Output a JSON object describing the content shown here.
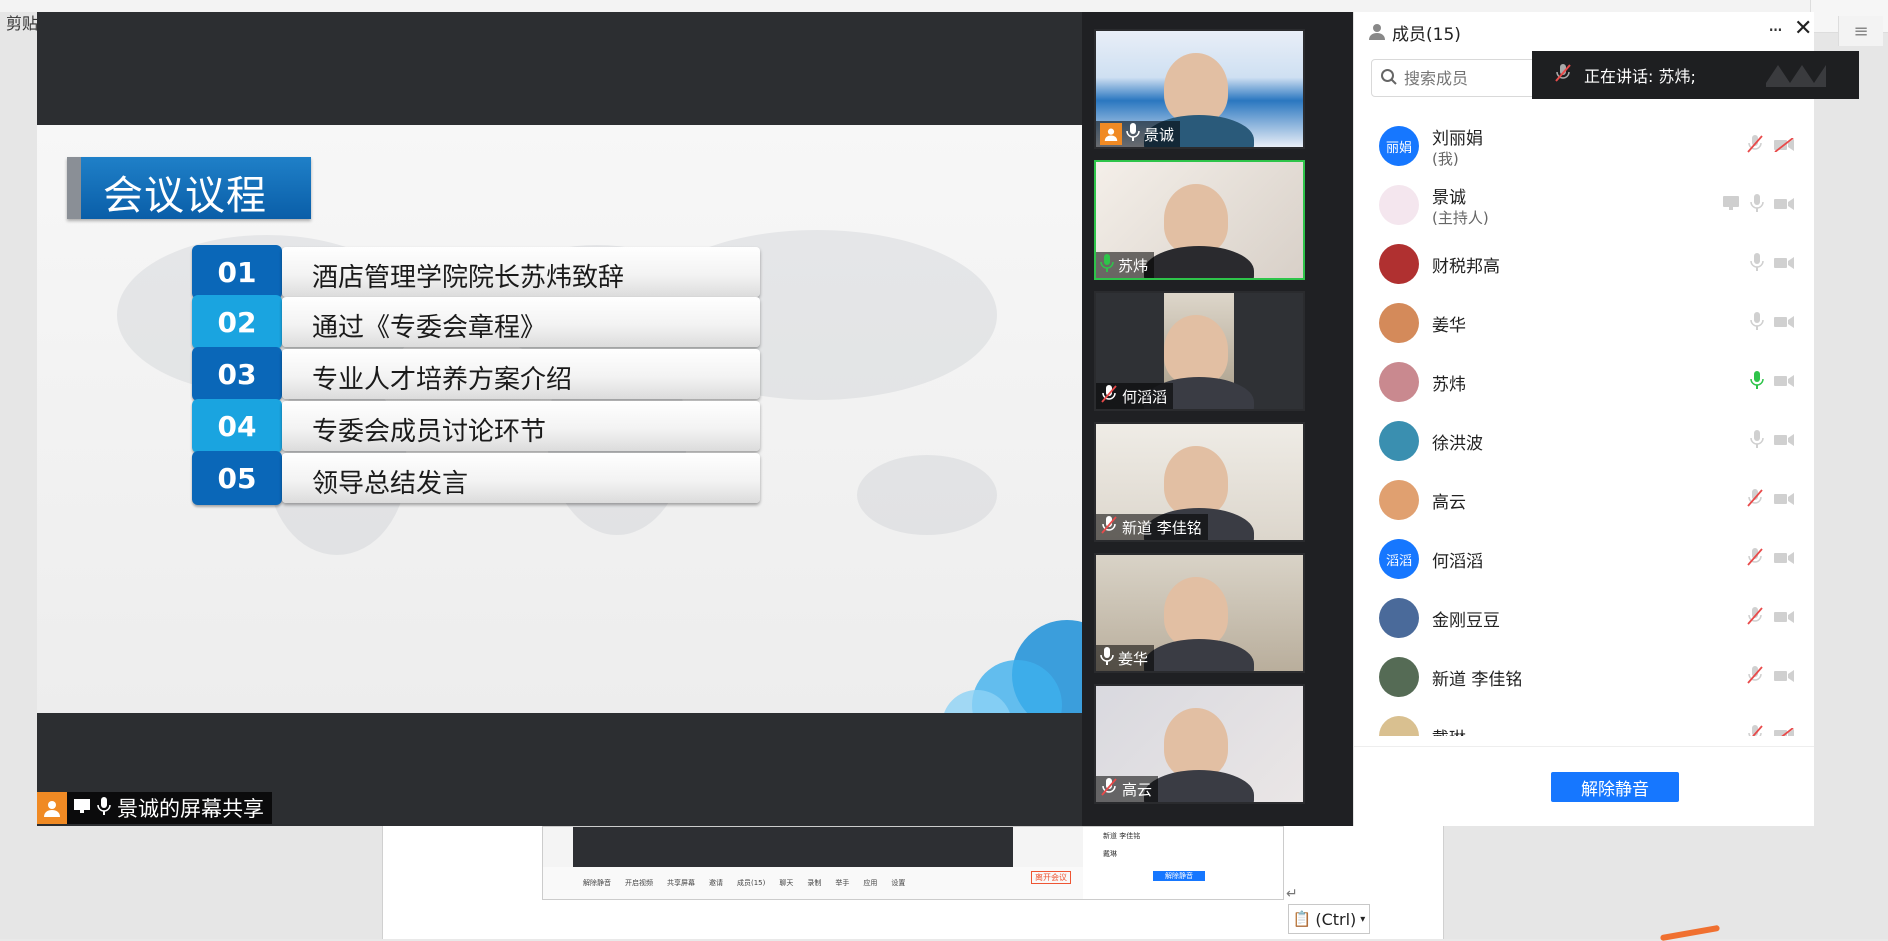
{
  "background_doc": {
    "left_corner": "剪贴",
    "ctrl_badge": "(Ctrl)",
    "mini_toolbar": [
      "解除静音",
      "开启视频",
      "共享屏幕",
      "邀请",
      "成员(15)",
      "聊天",
      "录制",
      "举手",
      "应用",
      "设置"
    ],
    "mini_leave": "离开会议",
    "mini_rows": [
      "新道 李佳铭",
      "戴琳"
    ],
    "mini_unmute": "解除静音"
  },
  "main_video": {
    "slide_title": "会议议程",
    "agenda": [
      {
        "num": "01",
        "text": "酒店管理学院院长苏炜致辞",
        "color": "#0a67b8"
      },
      {
        "num": "02",
        "text": "通过《专委会章程》",
        "color": "#1aa4e0"
      },
      {
        "num": "03",
        "text": "专业人才培养方案介绍",
        "color": "#0a67b8"
      },
      {
        "num": "04",
        "text": "专委会成员讨论环节",
        "color": "#1aa4e0"
      },
      {
        "num": "05",
        "text": "领导总结发言",
        "color": "#0a67b8"
      }
    ],
    "share_label": "景诚的屏幕共享"
  },
  "thumbnails": [
    {
      "name": "景诚",
      "mic": "on",
      "host": true
    },
    {
      "name": "苏炜",
      "mic": "speaking"
    },
    {
      "name": "何滔滔",
      "mic": "muted"
    },
    {
      "name": "新道 李佳铭",
      "mic": "muted"
    },
    {
      "name": "姜华",
      "mic": "on"
    },
    {
      "name": "高云",
      "mic": "muted"
    }
  ],
  "panel": {
    "title": "成员(15)",
    "more": "···",
    "close": "✕",
    "search_placeholder": "搜索成员",
    "speaking_text": "正在讲话: 苏炜;",
    "unmute_button": "解除静音"
  },
  "members": [
    {
      "name": "刘丽娟",
      "role": "(我)",
      "avatar_text": "丽娟",
      "avatar_color": "#1677ff",
      "mic": "muted-red",
      "cam": "off-red"
    },
    {
      "name": "景诚",
      "role": "(主持人)",
      "avatar_text": "",
      "avatar_color": "#f4e6ee",
      "mic": "on",
      "cam": "on",
      "share": true
    },
    {
      "name": "财税邦高",
      "role": "",
      "avatar_text": "",
      "avatar_color": "#b03030",
      "mic": "on",
      "cam": "on"
    },
    {
      "name": "姜华",
      "role": "",
      "avatar_text": "",
      "avatar_color": "#d48a5a",
      "mic": "on",
      "cam": "on"
    },
    {
      "name": "苏炜",
      "role": "",
      "avatar_text": "",
      "avatar_color": "#c9898f",
      "mic": "speaking",
      "cam": "on"
    },
    {
      "name": "徐洪波",
      "role": "",
      "avatar_text": "",
      "avatar_color": "#3a8fb0",
      "mic": "on",
      "cam": "on"
    },
    {
      "name": "高云",
      "role": "",
      "avatar_text": "",
      "avatar_color": "#e0a070",
      "mic": "muted-red",
      "cam": "on"
    },
    {
      "name": "何滔滔",
      "role": "",
      "avatar_text": "滔滔",
      "avatar_color": "#1677ff",
      "mic": "muted-red",
      "cam": "on"
    },
    {
      "name": "金刚豆豆",
      "role": "",
      "avatar_text": "",
      "avatar_color": "#4a6a9a",
      "mic": "muted-red",
      "cam": "on"
    },
    {
      "name": "新道 李佳铭",
      "role": "",
      "avatar_text": "",
      "avatar_color": "#556b55",
      "mic": "muted-red",
      "cam": "on"
    },
    {
      "name": "戴琳",
      "role": "",
      "avatar_text": "",
      "avatar_color": "#d9c090",
      "mic": "muted-red",
      "cam": "off-red"
    }
  ],
  "colors": {
    "accent": "#1677ff",
    "speaking_green": "#2ec44a",
    "muted_red": "#e84a4a"
  }
}
